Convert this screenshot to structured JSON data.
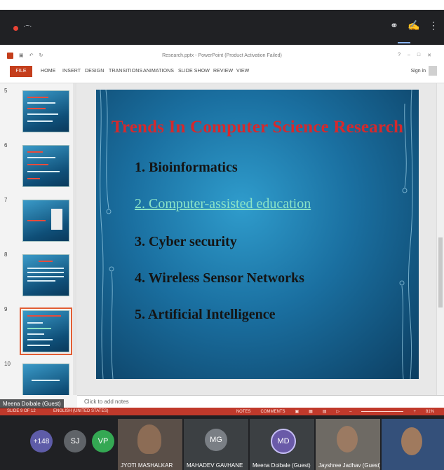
{
  "meet": {
    "rec_text": "·~·",
    "participants_count": "+148",
    "avatars": [
      {
        "initials": "SJ",
        "color": "#5f6368"
      },
      {
        "initials": "VP",
        "color": "#34a853"
      }
    ],
    "tiles": [
      {
        "name": "JYOTI MASHALKAR",
        "initials": ""
      },
      {
        "name": "MAHADEV GAVHANE",
        "initials": "MG"
      },
      {
        "name": "Meena Doibale (Guest)",
        "initials": "MD"
      },
      {
        "name": "Jayshree Jadhav (Guest)",
        "initials": ""
      },
      {
        "name": "",
        "initials": ""
      }
    ],
    "presenter_label": "Meena Doibale (Guest)"
  },
  "ppt": {
    "file_title": "Research.pptx - PowerPoint (Product Activation Failed)",
    "tabs": [
      "FILE",
      "HOME",
      "INSERT",
      "DESIGN",
      "TRANSITIONS",
      "ANIMATIONS",
      "SLIDE SHOW",
      "REVIEW",
      "VIEW"
    ],
    "sign_in": "Sign in",
    "thumbnails": [
      "5",
      "6",
      "7",
      "8",
      "9",
      "10"
    ],
    "selected_thumbnail": "9",
    "slide": {
      "title": "Trends In Computer Science Research",
      "items": [
        "1. Bioinformatics",
        "2. Computer-assisted education",
        "3. Cyber security",
        "4. Wireless Sensor Networks",
        "5. Artificial Intelligence"
      ]
    },
    "notes_placeholder": "Click to add notes",
    "status": {
      "slide_info": "SLIDE 9 OF 12",
      "language": "ENGLISH (UNITED STATES)",
      "notes": "NOTES",
      "comments": "COMMENTS",
      "zoom": "81%"
    }
  },
  "colors": {
    "meet_bg": "#202124",
    "ppt_accent": "#c43e1c",
    "slide_title": "#d6292c",
    "slide_link": "#8be3c6"
  }
}
